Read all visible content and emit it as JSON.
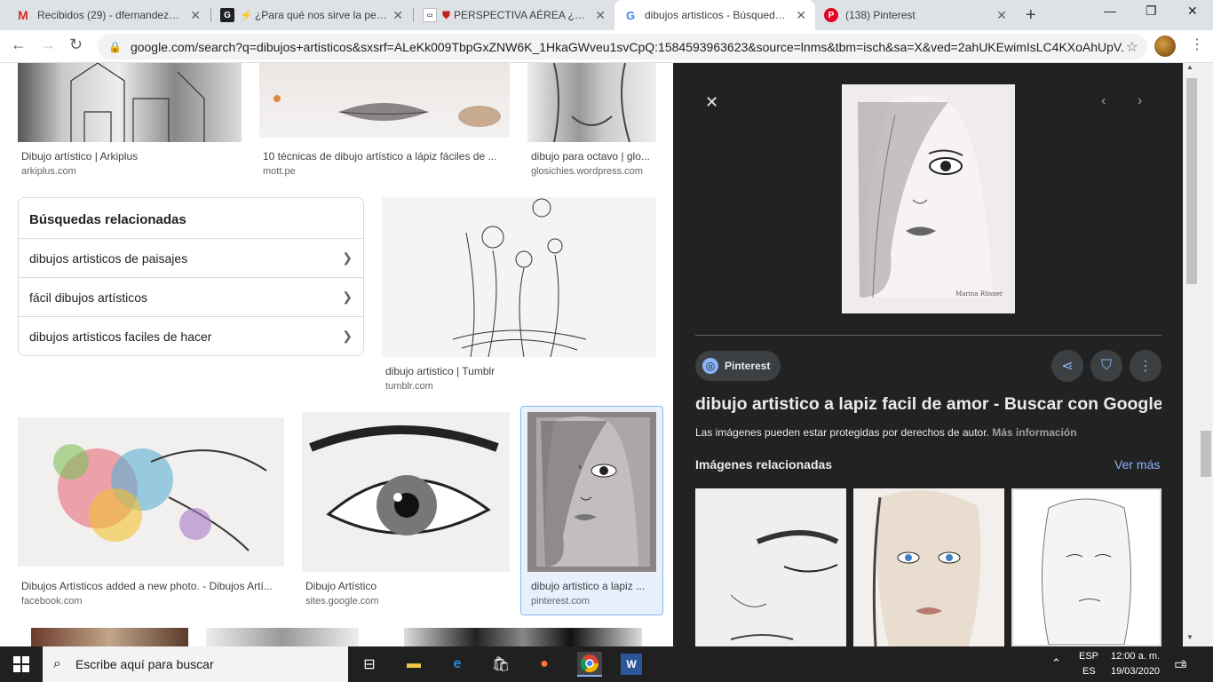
{
  "tabs": [
    {
      "title": "Recibidos (29) - dfernandezalva",
      "icon": "gmail-icon"
    },
    {
      "title": "¿Para qué nos sirve la persp",
      "icon": "g-icon"
    },
    {
      "title": "PERSPECTIVA AÉREA ¿Qué",
      "icon": "site-icon"
    },
    {
      "title": "dibujos artisticos - Búsqueda de",
      "icon": "google-icon"
    },
    {
      "title": "(138) Pinterest",
      "icon": "pinterest-icon"
    }
  ],
  "address": {
    "domain": "google.com",
    "url": "google.com/search?q=dibujos+artisticos&sxsrf=ALeKk009TbpGxZNW6K_1HkaGWveu1svCpQ:1584593963623&source=lnms&tbm=isch&sa=X&ved=2ahUKEwimIsLC4KXoAhUpV..."
  },
  "results_top": [
    {
      "caption": "Dibujo artístico | Arkiplus",
      "source": "arkiplus.com"
    },
    {
      "caption": "10 técnicas de dibujo artístico a lápiz fáciles de ...",
      "source": "mott.pe"
    },
    {
      "caption": "dibujo para octavo | glo...",
      "source": "glosichies.wordpress.com"
    }
  ],
  "related": {
    "title": "Búsquedas relacionadas",
    "items": [
      "dibujos artisticos de paisajes",
      "fácil dibujos artísticos",
      "dibujos artisticos faciles de hacer"
    ]
  },
  "tumblr": {
    "caption": "dibujo artistico | Tumblr",
    "source": "tumblr.com"
  },
  "results_bottom": [
    {
      "caption": "Dibujos Artísticos added a new photo. - Dibujos Artí...",
      "source": "facebook.com"
    },
    {
      "caption": "Dibujo Artístico",
      "source": "sites.google.com"
    },
    {
      "caption": "dibujo artistico a lapiz ...",
      "source": "pinterest.com"
    }
  ],
  "panel": {
    "site_label": "Pinterest",
    "title": "dibujo artistico a lapiz facil de amor - Buscar con Google ...",
    "copyright": "Las imágenes pueden estar protegidas por derechos de autor.",
    "more_info": "Más información",
    "related_heading": "Imágenes relacionadas",
    "see_more": "Ver más",
    "signature": "Marina Rüsner"
  },
  "taskbar": {
    "search_placeholder": "Escribe aquí para buscar",
    "lang_top": "ESP",
    "lang_bottom": "ES",
    "time": "12:00 a. m.",
    "date": "19/03/2020",
    "notifications": "2"
  },
  "colors": {
    "accent": "#1a73e8",
    "panel_bg": "#222222",
    "link_dark": "#8ab4f8",
    "tabbar": "#dee1e6"
  }
}
